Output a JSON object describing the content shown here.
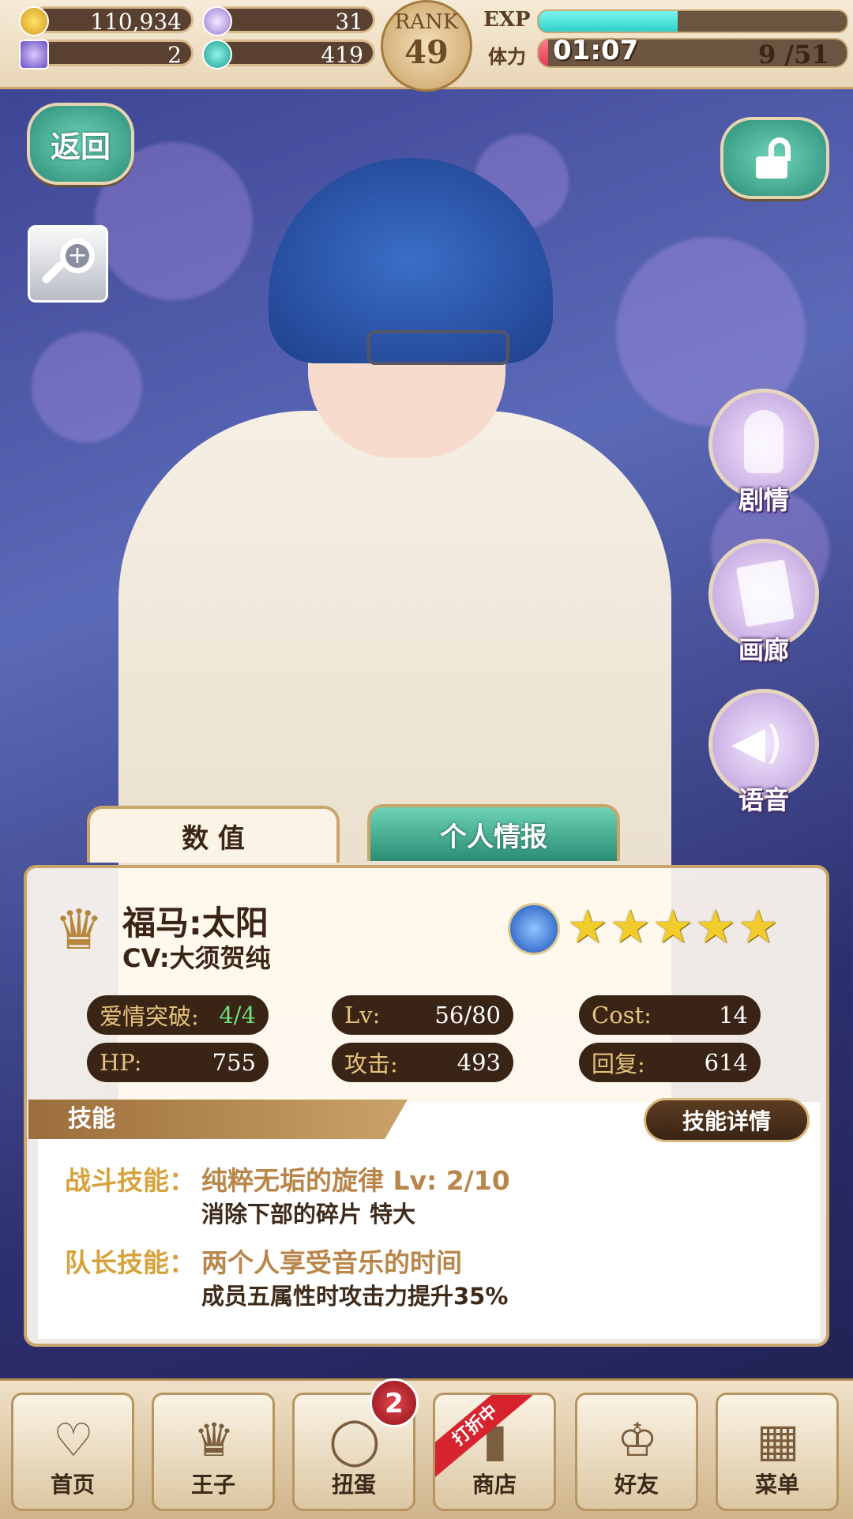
{
  "currency": {
    "gold": "110,934",
    "feather": "31",
    "crystal": "2",
    "gem": "419"
  },
  "rank": {
    "label": "RANK",
    "value": "49"
  },
  "exp": {
    "label": "EXP",
    "progress": 0.45
  },
  "stamina": {
    "label": "体力",
    "timer": "01:07",
    "count": "9 /51",
    "progress": 0.03
  },
  "buttons": {
    "back": "返回",
    "story": "剧情",
    "gallery": "画廊",
    "voice": "语音"
  },
  "tabs": {
    "stats": "数 值",
    "profile": "个人情报"
  },
  "character": {
    "name": "福马:太阳",
    "cv": "CV:大须贺纯",
    "stars": 5
  },
  "stats": [
    {
      "key": "爱情突破:",
      "value": "4/4"
    },
    {
      "key": "Lv:",
      "value": "56/80"
    },
    {
      "key": "Cost:",
      "value": "14"
    },
    {
      "key": "HP:",
      "value": "755"
    },
    {
      "key": "攻击:",
      "value": "493"
    },
    {
      "key": "回复:",
      "value": "614"
    }
  ],
  "skills": {
    "header": "技能",
    "detail_button": "技能详情",
    "battle": {
      "label": "战斗技能：",
      "name": "纯粹无垢的旋律 Lv: 2/10",
      "desc": "消除下部的碎片 特大"
    },
    "leader": {
      "label": "队长技能：",
      "name": "两个人享受音乐的时间",
      "desc": "成员五属性时攻击力提升35%"
    }
  },
  "nav": {
    "home": "首页",
    "prince": "王子",
    "gacha": "扭蛋",
    "gacha_badge": "2",
    "shop": "商店",
    "shop_ribbon": "打折中",
    "friends": "好友",
    "menu": "菜单"
  },
  "colors": {
    "accent_teal": "#2e8d79",
    "gold": "#c9a56b",
    "dark_brown": "#3a2416"
  }
}
